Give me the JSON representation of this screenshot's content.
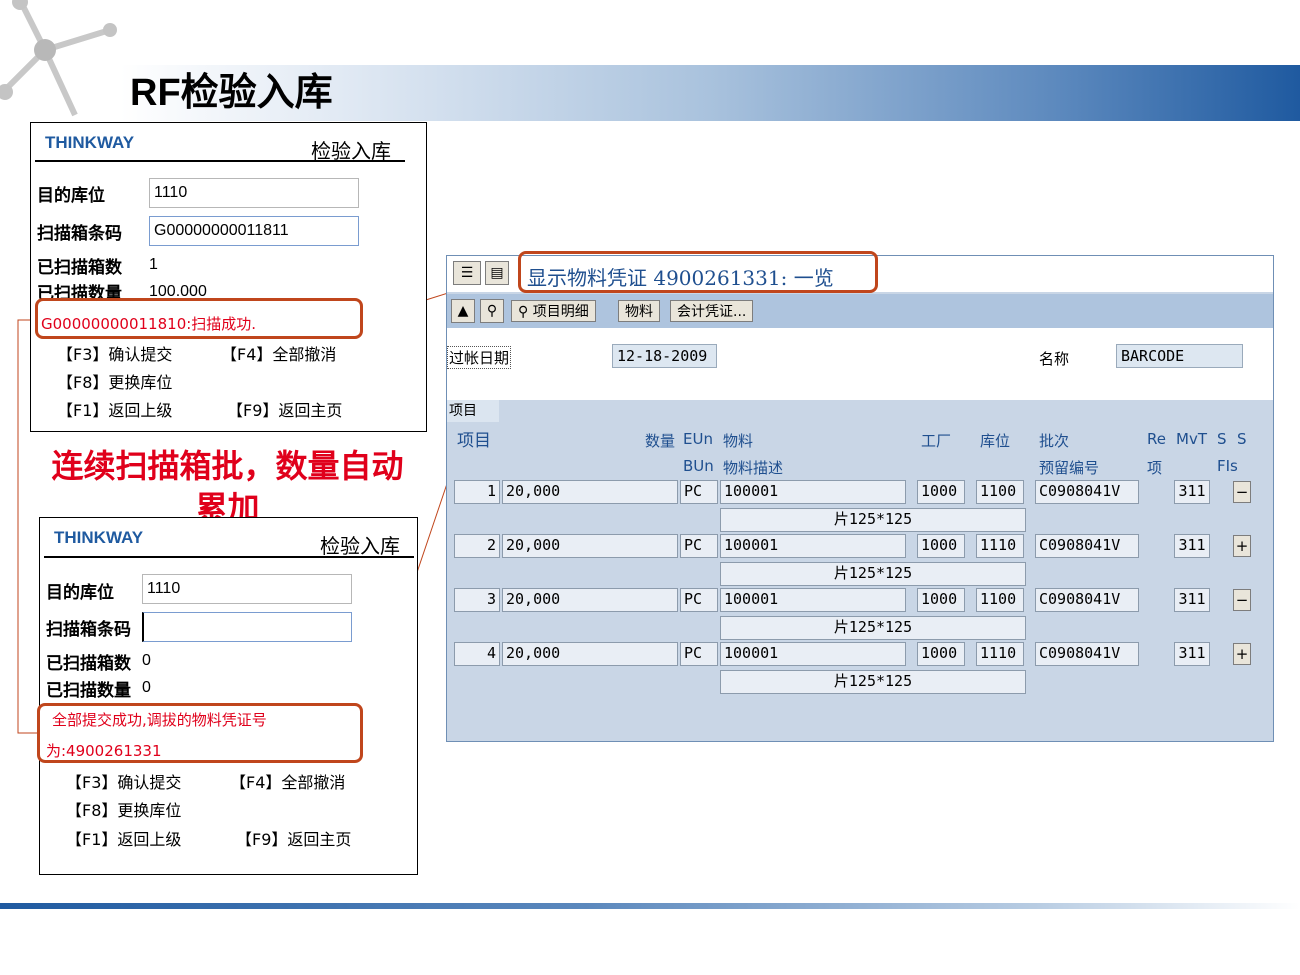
{
  "slide": {
    "title": "RF检验入库",
    "caption": "连续扫描箱批，数量自动累加"
  },
  "rf_top": {
    "brand": "THINKWAY",
    "title": "检验入库",
    "fields": [
      {
        "label": "目的库位",
        "value": "1110"
      },
      {
        "label": "扫描箱条码",
        "value": "G00000000011811"
      },
      {
        "label": "已扫描箱数",
        "value": "1"
      },
      {
        "label": "已扫描数量",
        "value": "100.000"
      }
    ],
    "message": "G00000000011810:扫描成功.",
    "keys": [
      "【F3】确认提交",
      "【F4】全部撤消",
      "【F8】更换库位",
      "【F1】返回上级",
      "【F9】返回主页"
    ]
  },
  "rf_bottom": {
    "brand": "THINKWAY",
    "title": "检验入库",
    "fields": [
      {
        "label": "目的库位",
        "value": "1110"
      },
      {
        "label": "扫描箱条码",
        "value": ""
      },
      {
        "label": "已扫描箱数",
        "value": "0"
      },
      {
        "label": "已扫描数量",
        "value": "0"
      }
    ],
    "message_line1": "全部提交成功,调拔的物料凭证号",
    "message_line2": "为:4900261331",
    "keys": [
      "【F3】确认提交",
      "【F4】全部撤消",
      "【F8】更换库位",
      "【F1】返回上级",
      "【F9】返回主页"
    ]
  },
  "sap": {
    "title": "显示物料凭证 4900261331: 一览",
    "toolbar": [
      "项目明细",
      "物料",
      "会计凭证..."
    ],
    "posting_date_label": "过帐日期",
    "posting_date": "12-18-2009",
    "name_label": "名称",
    "name_value": "BARCODE",
    "section_tab": "项目",
    "columns": {
      "item": "项目",
      "qty": "数量",
      "eun": "EUn",
      "bun": "BUn",
      "material": "物料",
      "material_desc": "物料描述",
      "plant": "工厂",
      "sloc": "库位",
      "batch": "批次",
      "reservation": "预留编号",
      "re": "Re",
      "re_item": "项",
      "mvt": "MvT",
      "s1": "S",
      "s2": "S",
      "fis": "FIs"
    },
    "rows": [
      {
        "item": "1",
        "qty": "20,000",
        "unit": "PC",
        "material": "100001",
        "plant": "1000",
        "sloc": "1100",
        "batch": "C0908041V",
        "mvt": "311",
        "sign": "−",
        "desc": "片125*125"
      },
      {
        "item": "2",
        "qty": "20,000",
        "unit": "PC",
        "material": "100001",
        "plant": "1000",
        "sloc": "1110",
        "batch": "C0908041V",
        "mvt": "311",
        "sign": "+",
        "desc": "片125*125"
      },
      {
        "item": "3",
        "qty": "20,000",
        "unit": "PC",
        "material": "100001",
        "plant": "1000",
        "sloc": "1100",
        "batch": "C0908041V",
        "mvt": "311",
        "sign": "−",
        "desc": "片125*125"
      },
      {
        "item": "4",
        "qty": "20,000",
        "unit": "PC",
        "material": "100001",
        "plant": "1000",
        "sloc": "1110",
        "batch": "C0908041V",
        "mvt": "311",
        "sign": "+",
        "desc": "片125*125"
      }
    ]
  },
  "colors": {
    "accent_red": "#e0001b",
    "highlight_orange": "#c0461c",
    "brand_blue": "#1f5aa0",
    "sap_bg": "#c9d6e6"
  }
}
